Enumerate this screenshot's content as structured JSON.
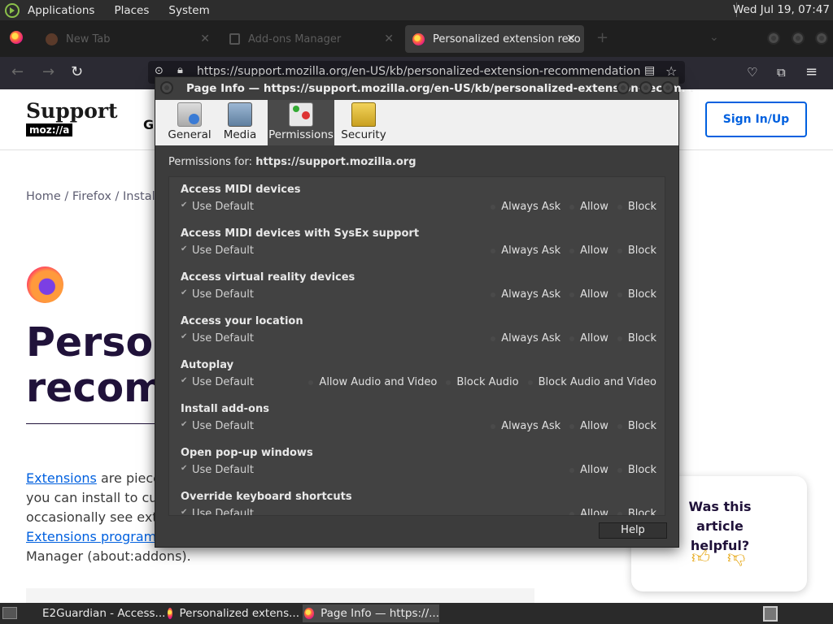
{
  "top_panel": {
    "menus": [
      "Applications",
      "Places",
      "System"
    ],
    "clock": "Wed Jul 19, 07:47"
  },
  "browser": {
    "tabs": [
      {
        "label": "New Tab"
      },
      {
        "label": "Add-ons Manager"
      },
      {
        "label": "Personalized extension reco"
      }
    ],
    "url": "https://support.mozilla.org/en-US/kb/personalized-extension-recommendations?as=u"
  },
  "page": {
    "brand_support": "Support",
    "brand_mozilla": "moz://a",
    "nav_partial": "G",
    "sign_in": "Sign In/Up",
    "breadcrumb": "Home / Firefox / Install a",
    "title_line1": "Person",
    "title_line2": "recomm",
    "body": {
      "link1": "Extensions",
      "line1_rest": " are piece",
      "line2": "you can install to cus",
      "line3": "occasionally see exte",
      "link2": "Extensions program",
      "line5": "Manager (about:addons)."
    },
    "helpful": "Was this article helpful?"
  },
  "dialog": {
    "title": "Page Info — https://support.mozilla.org/en-US/kb/personalized-extension-recom...",
    "tabs": [
      "General",
      "Media",
      "Permissions",
      "Security"
    ],
    "active_tab": "Permissions",
    "permissions_for_label": "Permissions for:",
    "permissions_for_site": "https://support.mozilla.org",
    "use_default": "Use Default",
    "permissions": [
      {
        "name": "Access MIDI devices",
        "options": [
          "Always Ask",
          "Allow",
          "Block"
        ]
      },
      {
        "name": "Access MIDI devices with SysEx support",
        "options": [
          "Always Ask",
          "Allow",
          "Block"
        ]
      },
      {
        "name": "Access virtual reality devices",
        "options": [
          "Always Ask",
          "Allow",
          "Block"
        ]
      },
      {
        "name": "Access your location",
        "options": [
          "Always Ask",
          "Allow",
          "Block"
        ]
      },
      {
        "name": "Autoplay",
        "options": [
          "Allow Audio and Video",
          "Block Audio",
          "Block Audio and Video"
        ]
      },
      {
        "name": "Install add-ons",
        "options": [
          "Always Ask",
          "Allow",
          "Block"
        ]
      },
      {
        "name": "Open pop-up windows",
        "options": [
          "Allow",
          "Block"
        ]
      },
      {
        "name": "Override keyboard shortcuts",
        "options": [
          "Allow",
          "Block"
        ]
      }
    ],
    "help": "Help"
  },
  "taskbar": {
    "items": [
      "E2Guardian - Access...",
      "Personalized extens...",
      "Page Info — https://..."
    ],
    "active_index": 2
  }
}
